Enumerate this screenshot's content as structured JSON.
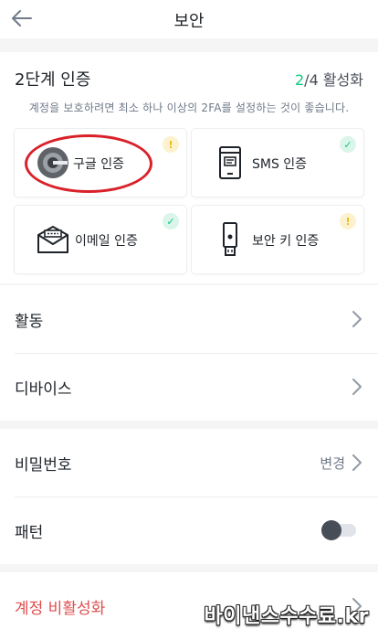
{
  "header": {
    "title": "보안",
    "back_icon": "arrow-left-icon"
  },
  "twofa": {
    "title": "2단계 인증",
    "count_enabled": "2",
    "count_rest": "/4 활성화",
    "description": "계정을 보호하려면 최소 하나 이상의 2FA를 설정하는 것이 좋습니다.",
    "methods": [
      {
        "label": "구글 인증",
        "icon": "google-authenticator-icon",
        "status": "warning",
        "badge": "!"
      },
      {
        "label": "SMS 인증",
        "icon": "sms-phone-icon",
        "status": "enabled",
        "badge": "✓"
      },
      {
        "label": "이메일 인증",
        "icon": "email-icon",
        "status": "enabled",
        "badge": "✓"
      },
      {
        "label": "보안 키 인증",
        "icon": "security-key-icon",
        "status": "warning",
        "badge": "!"
      }
    ]
  },
  "section_activity": {
    "items": [
      {
        "label": "활동"
      },
      {
        "label": "디바이스"
      }
    ]
  },
  "section_login": {
    "password": {
      "label": "비밀번호",
      "value": "변경"
    },
    "pattern": {
      "label": "패턴",
      "enabled": false
    }
  },
  "section_danger": {
    "label": "계정 비활성화"
  },
  "watermark": "바이낸스수수료.kr",
  "colors": {
    "accent": "#0ecb81",
    "warning": "#f0b90b",
    "danger": "#e04d4d",
    "highlight": "#d9212a"
  }
}
